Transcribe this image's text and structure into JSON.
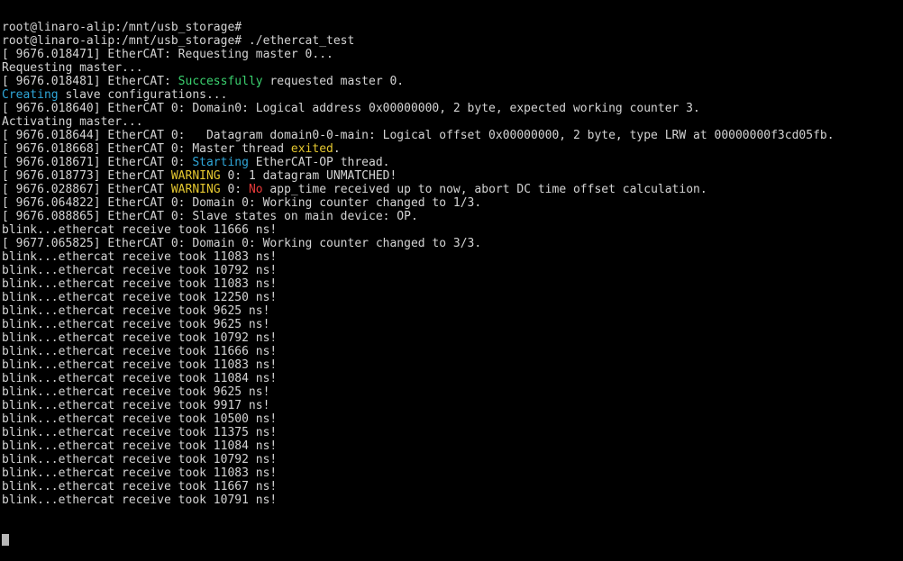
{
  "colors": {
    "background": "#000000",
    "text": "#d4d4d4",
    "green": "#3bd16f",
    "cyan": "#2fa6d8",
    "yellow": "#e5c830",
    "red": "#e83a3a"
  },
  "terminal": {
    "lines": [
      {
        "segments": [
          {
            "text": "root@linaro-alip:/mnt/usb_storage#"
          }
        ]
      },
      {
        "segments": [
          {
            "text": "root@linaro-alip:/mnt/usb_storage# ./ethercat_test"
          }
        ]
      },
      {
        "segments": [
          {
            "text": "[ 9676.018471] EtherCAT: Requesting master 0..."
          }
        ]
      },
      {
        "segments": [
          {
            "text": "Requesting master..."
          }
        ]
      },
      {
        "segments": [
          {
            "text": "[ 9676.018481] EtherCAT: "
          },
          {
            "text": "Successfully",
            "color": "green"
          },
          {
            "text": " requested master 0."
          }
        ]
      },
      {
        "segments": [
          {
            "text": "Creating",
            "color": "cyan"
          },
          {
            "text": " slave configurations..."
          }
        ]
      },
      {
        "segments": [
          {
            "text": "[ 9676.018640] EtherCAT 0: Domain0: Logical address 0x00000000, 2 byte, expected working counter 3."
          }
        ]
      },
      {
        "segments": [
          {
            "text": "Activating master..."
          }
        ]
      },
      {
        "segments": [
          {
            "text": "[ 9676.018644] EtherCAT 0:   Datagram domain0-0-main: Logical offset 0x00000000, 2 byte, type LRW at 00000000f3cd05fb."
          }
        ]
      },
      {
        "segments": [
          {
            "text": "[ 9676.018668] EtherCAT 0: Master thread "
          },
          {
            "text": "exited",
            "color": "yellow"
          },
          {
            "text": "."
          }
        ]
      },
      {
        "segments": [
          {
            "text": "[ 9676.018671] EtherCAT 0: "
          },
          {
            "text": "Starting",
            "color": "cyan"
          },
          {
            "text": " EtherCAT-OP thread."
          }
        ]
      },
      {
        "segments": [
          {
            "text": "[ 9676.018773] EtherCAT "
          },
          {
            "text": "WARNING",
            "color": "yellow"
          },
          {
            "text": " 0: 1 datagram UNMATCHED!"
          }
        ]
      },
      {
        "segments": [
          {
            "text": "[ 9676.028867] EtherCAT "
          },
          {
            "text": "WARNING",
            "color": "yellow"
          },
          {
            "text": " 0: "
          },
          {
            "text": "No",
            "color": "red"
          },
          {
            "text": " app_time received up to now, abort DC time offset calculation."
          }
        ]
      },
      {
        "segments": [
          {
            "text": "[ 9676.064822] EtherCAT 0: Domain 0: Working counter changed to 1/3."
          }
        ]
      },
      {
        "segments": [
          {
            "text": "[ 9676.088865] EtherCAT 0: Slave states on main device: OP."
          }
        ]
      },
      {
        "segments": [
          {
            "text": "blink...ethercat receive took 11666 ns!"
          }
        ]
      },
      {
        "segments": [
          {
            "text": "[ 9677.065825] EtherCAT 0: Domain 0: Working counter changed to 3/3."
          }
        ]
      },
      {
        "segments": [
          {
            "text": "blink...ethercat receive took 11083 ns!"
          }
        ]
      },
      {
        "segments": [
          {
            "text": "blink...ethercat receive took 10792 ns!"
          }
        ]
      },
      {
        "segments": [
          {
            "text": "blink...ethercat receive took 11083 ns!"
          }
        ]
      },
      {
        "segments": [
          {
            "text": "blink...ethercat receive took 12250 ns!"
          }
        ]
      },
      {
        "segments": [
          {
            "text": "blink...ethercat receive took 9625 ns!"
          }
        ]
      },
      {
        "segments": [
          {
            "text": "blink...ethercat receive took 9625 ns!"
          }
        ]
      },
      {
        "segments": [
          {
            "text": "blink...ethercat receive took 10792 ns!"
          }
        ]
      },
      {
        "segments": [
          {
            "text": "blink...ethercat receive took 11666 ns!"
          }
        ]
      },
      {
        "segments": [
          {
            "text": "blink...ethercat receive took 11083 ns!"
          }
        ]
      },
      {
        "segments": [
          {
            "text": "blink...ethercat receive took 11084 ns!"
          }
        ]
      },
      {
        "segments": [
          {
            "text": "blink...ethercat receive took 9625 ns!"
          }
        ]
      },
      {
        "segments": [
          {
            "text": "blink...ethercat receive took 9917 ns!"
          }
        ]
      },
      {
        "segments": [
          {
            "text": "blink...ethercat receive took 10500 ns!"
          }
        ]
      },
      {
        "segments": [
          {
            "text": "blink...ethercat receive took 11375 ns!"
          }
        ]
      },
      {
        "segments": [
          {
            "text": "blink...ethercat receive took 11084 ns!"
          }
        ]
      },
      {
        "segments": [
          {
            "text": "blink...ethercat receive took 10792 ns!"
          }
        ]
      },
      {
        "segments": [
          {
            "text": "blink...ethercat receive took 11083 ns!"
          }
        ]
      },
      {
        "segments": [
          {
            "text": "blink...ethercat receive took 11667 ns!"
          }
        ]
      },
      {
        "segments": [
          {
            "text": "blink...ethercat receive took 10791 ns!"
          }
        ]
      }
    ]
  }
}
